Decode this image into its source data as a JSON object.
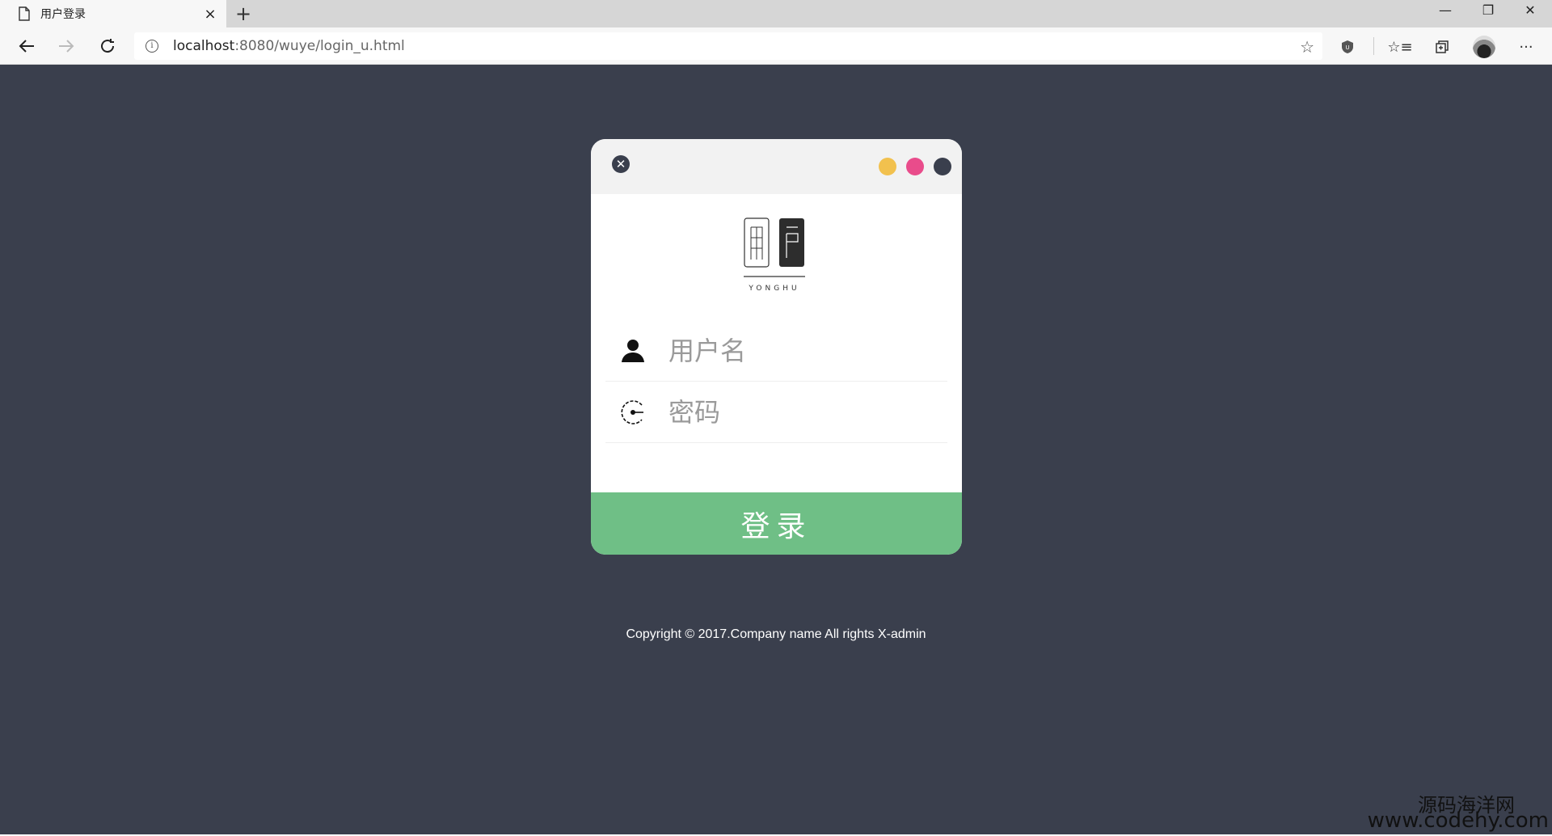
{
  "browser": {
    "tab_title": "用户登录",
    "tab_close": "×",
    "new_tab": "+",
    "url_host": "localhost",
    "url_rest": ":8080/wuye/login_u.html",
    "minimize": "—",
    "restore": "❐",
    "close": "✕"
  },
  "login": {
    "username_placeholder": "用户名",
    "password_placeholder": "密码",
    "button_label": "登录",
    "logo_text": "YONGHU",
    "dots": [
      "#f2c14e",
      "#e94c8b",
      "#3a3f4d"
    ]
  },
  "footer": {
    "copyright": "Copyright © 2017.Company name All rights X-admin"
  },
  "watermark": {
    "line1": "源码海洋网",
    "line2": "www.codehy.com"
  },
  "colors": {
    "background": "#3a3f4d",
    "button": "#6fbf86"
  }
}
